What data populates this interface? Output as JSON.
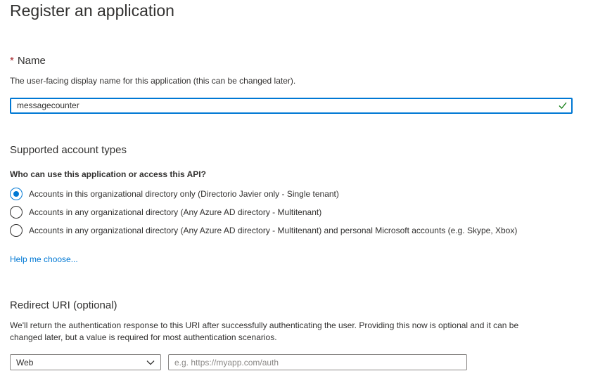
{
  "page_title": "Register an application",
  "name_section": {
    "required_marker": "*",
    "heading": "Name",
    "description": "The user-facing display name for this application (this can be changed later).",
    "input_value": "messagecounter"
  },
  "account_types": {
    "heading": "Supported account types",
    "question": "Who can use this application or access this API?",
    "options": [
      {
        "label": "Accounts in this organizational directory only (Directorio Javier only - Single tenant)",
        "checked": true
      },
      {
        "label": "Accounts in any organizational directory (Any Azure AD directory - Multitenant)",
        "checked": false
      },
      {
        "label": "Accounts in any organizational directory (Any Azure AD directory - Multitenant) and personal Microsoft accounts (e.g. Skype, Xbox)",
        "checked": false
      }
    ],
    "help_link": "Help me choose..."
  },
  "redirect_uri": {
    "heading": "Redirect URI (optional)",
    "description_line1": "We'll return the authentication response to this URI after successfully authenticating the user. Providing this now is optional and it can be",
    "description_line2": "changed later, but a value is required for most authentication scenarios.",
    "platform_selected": "Web",
    "uri_placeholder": "e.g. https://myapp.com/auth"
  },
  "colors": {
    "accent": "#0078d4",
    "valid_check": "#107c10",
    "required": "#a4262c",
    "text": "#323130"
  },
  "icons": {
    "valid": "check-icon",
    "dropdown": "chevron-down-icon"
  }
}
